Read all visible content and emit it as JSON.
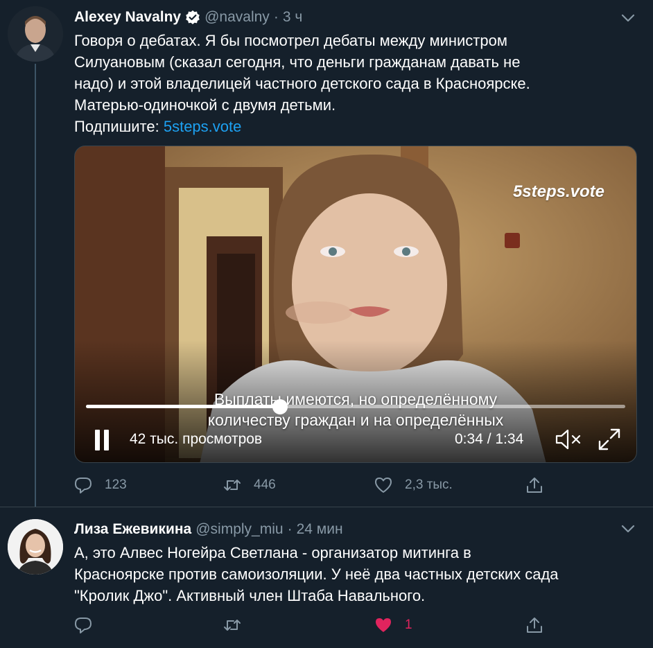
{
  "tweets": [
    {
      "author": "Alexey Navalny",
      "handle": "@navalny",
      "separator": "·",
      "time": "3 ч",
      "verified": true,
      "text": "Говоря о дебатах. Я бы посмотрел дебаты между министром\nСилуановым (сказал сегодня, что деньги гражданам давать не\nнадо) и этой владелицей частного детского сада в Красноярске.\nМатерью-одиночкой с двумя детьми.\nПодпишите: ",
      "link": "5steps.vote",
      "video": {
        "watermark": "5steps.vote",
        "subtitle_line1": "Выплаты имеются, но определённому",
        "subtitle_line2": "количеству граждан и на определённых",
        "views": "42 тыс. просмотров",
        "time": "0:34 / 1:34",
        "progress": 0.36
      },
      "actions": {
        "replies": "123",
        "retweets": "446",
        "likes": "2,3 тыс.",
        "liked": false
      }
    },
    {
      "author": "Лиза Ежевикина",
      "handle": "@simply_miu",
      "separator": "·",
      "time": "24 мин",
      "verified": false,
      "text": "А, это Алвес Ногейра Светлана - организатор митинга в\nКрасноярске против самоизоляции. У неё два частных детских сада\n\"Кролик Джо\". Активный член Штаба Навального.",
      "actions": {
        "replies": "",
        "retweets": "",
        "likes": "1",
        "liked": true
      }
    }
  ],
  "colors": {
    "background": "#15202b",
    "text": "#ffffff",
    "secondary": "#8899a6",
    "link": "#1da1f2",
    "like": "#e0245e",
    "divider": "#38444d"
  },
  "icons": [
    "verified-icon",
    "chevron-down-icon",
    "reply-icon",
    "retweet-icon",
    "like-icon",
    "share-icon",
    "pause-icon",
    "mute-icon",
    "fullscreen-icon"
  ]
}
